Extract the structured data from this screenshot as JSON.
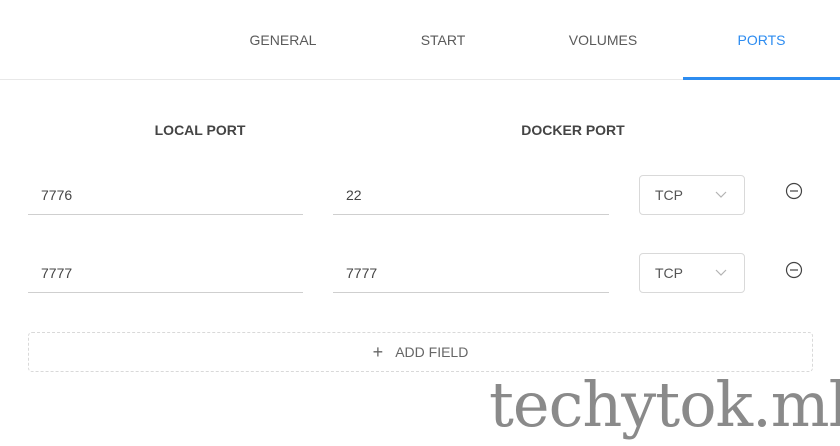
{
  "tabs": {
    "general": "GENERAL",
    "start": "START",
    "volumes": "VOLUMES",
    "ports": "PORTS",
    "active": "PORTS"
  },
  "accent_color": "#2d8cf0",
  "columns": {
    "local_port": "LOCAL PORT",
    "docker_port": "DOCKER PORT"
  },
  "rows": [
    {
      "local": "7776",
      "docker": "22",
      "protocol": "TCP"
    },
    {
      "local": "7777",
      "docker": "7777",
      "protocol": "TCP"
    }
  ],
  "add_field_label": "ADD FIELD",
  "watermark": "techytok.ml",
  "icons": {
    "remove": "minus-circle-icon",
    "chevron": "chevron-down-icon",
    "add": "plus-icon"
  }
}
